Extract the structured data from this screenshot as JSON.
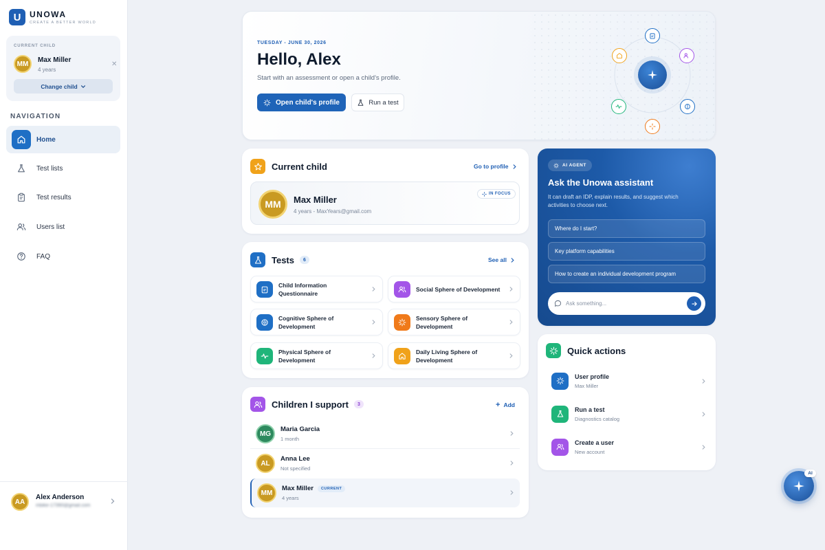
{
  "brand": {
    "name": "UNOWA",
    "tagline": "CREATE A BETTER WORLD",
    "logo_letter": "U"
  },
  "sidebar_child": {
    "label": "CURRENT CHILD",
    "initials": "MM",
    "name": "Max Miller",
    "age": "4 years",
    "change_label": "Change child"
  },
  "navigation": {
    "title": "NAVIGATION",
    "items": [
      {
        "label": "Home",
        "icon": "home-icon",
        "active": true
      },
      {
        "label": "Test lists",
        "icon": "flask-icon",
        "active": false
      },
      {
        "label": "Test results",
        "icon": "clipboard-icon",
        "active": false
      },
      {
        "label": "Users list",
        "icon": "users-icon",
        "active": false
      },
      {
        "label": "FAQ",
        "icon": "help-circle-icon",
        "active": false
      }
    ]
  },
  "sidebar_user": {
    "initials": "AA",
    "name": "Alex Anderson",
    "email": "mbike-17390@gmail.com"
  },
  "hero": {
    "date": "TUESDAY - JUNE 30, 2026",
    "greeting": "Hello, Alex",
    "subtitle": "Start with an assessment or open a child's profile.",
    "primary_button": "Open child's profile",
    "secondary_button": "Run a test"
  },
  "current_child": {
    "title": "Current child",
    "link": "Go to profile",
    "initials": "MM",
    "name": "Max Miller",
    "meta": "4 years - MaxYears@gmail.com",
    "badge": "IN FOCUS"
  },
  "tests": {
    "title": "Tests",
    "count": "6",
    "link": "See all",
    "items": [
      {
        "label": "Child Information Questionnaire",
        "icon": "clipboard-icon",
        "color": "#1f6fc5"
      },
      {
        "label": "Social Sphere of Development",
        "icon": "users-icon",
        "color": "#a355e8"
      },
      {
        "label": "Cognitive Sphere of Development",
        "icon": "brain-icon",
        "color": "#1f6fc5"
      },
      {
        "label": "Sensory Sphere of Development",
        "icon": "sparkle-icon",
        "color": "#f07a1a"
      },
      {
        "label": "Physical Sphere of Development",
        "icon": "pulse-icon",
        "color": "#1fb57a"
      },
      {
        "label": "Daily Living Sphere of Development",
        "icon": "home-icon",
        "color": "#f0a21a"
      }
    ]
  },
  "children": {
    "title": "Children I support",
    "count": "3",
    "add_label": "Add",
    "items": [
      {
        "initials": "MG",
        "name": "Maria Garcia",
        "sub": "1 month",
        "badge": "",
        "color": "#2e8a5e",
        "ring": "#8fd1ac"
      },
      {
        "initials": "AL",
        "name": "Anna Lee",
        "sub": "Not specified",
        "badge": "",
        "color": "#c99a22",
        "ring": "#f2d372"
      },
      {
        "initials": "MM",
        "name": "Max Miller",
        "sub": "4 years",
        "badge": "CURRENT",
        "color": "#c99a22",
        "ring": "#f2d372"
      }
    ]
  },
  "assistant": {
    "badge": "AI AGENT",
    "title": "Ask the Unowa assistant",
    "description": "It can draft an IDP, explain results, and suggest which activities to choose next.",
    "suggestions": [
      "Where do I start?",
      "Key platform capabilities",
      "How to create an individual development program"
    ],
    "input_placeholder": "Ask something..."
  },
  "quick_actions": {
    "title": "Quick actions",
    "items": [
      {
        "title": "User profile",
        "sub": "Max Miller",
        "icon": "sparkle-icon",
        "color": "#1f6fc5"
      },
      {
        "title": "Run a test",
        "sub": "Diagnostics catalog",
        "icon": "flask-icon",
        "color": "#1fb57a"
      },
      {
        "title": "Create a user",
        "sub": "New account",
        "icon": "users-icon",
        "color": "#a355e8"
      }
    ]
  },
  "fab": {
    "tag": "AI"
  },
  "colors": {
    "accent": "#1f64b8",
    "background": "#eef1f6",
    "assistant_bg": "#1d5aa8",
    "tests_icon": "#1f6fc5",
    "current_child_icon": "#f0a21a",
    "children_icon": "#a355e8",
    "quick_actions_icon": "#1fb57a"
  }
}
